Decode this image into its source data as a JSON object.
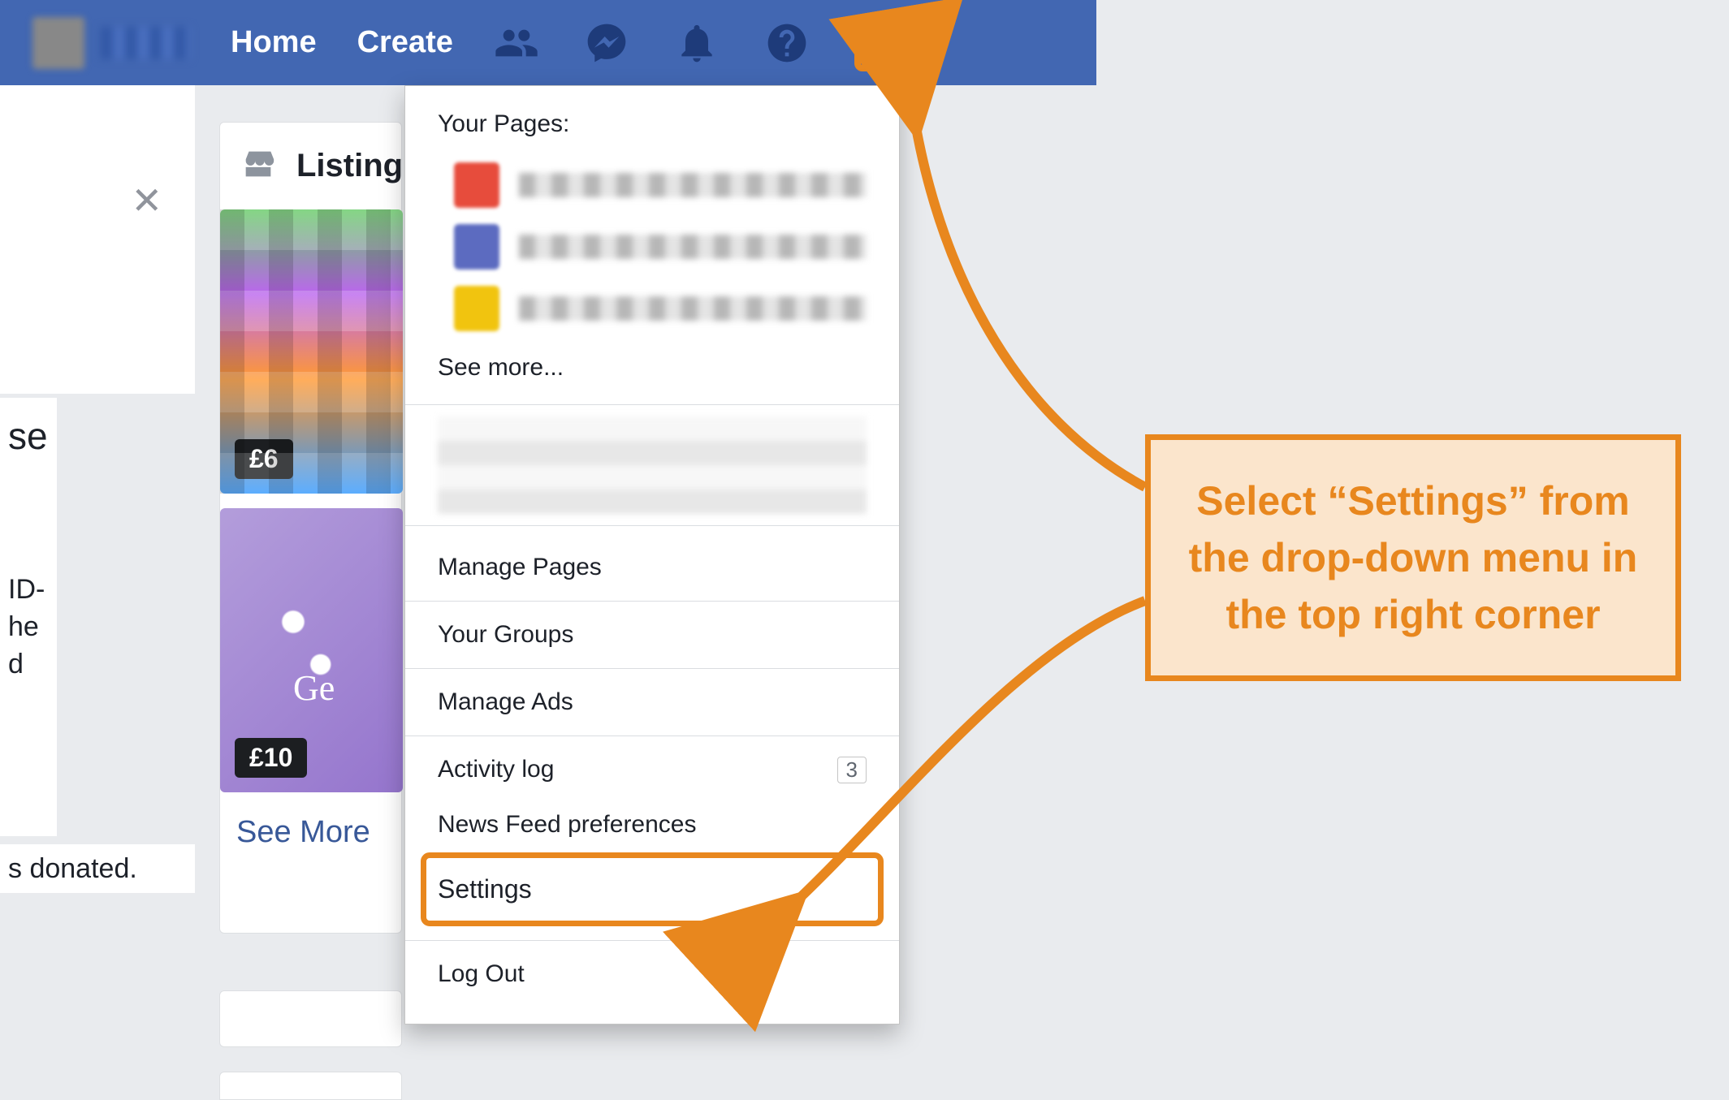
{
  "topbar": {
    "nav": {
      "home": "Home",
      "create": "Create"
    }
  },
  "left": {
    "se_line": "se",
    "sub_line": "ID-\nhe\nd",
    "donated_line": "s donated."
  },
  "listing": {
    "header": "Listing",
    "prices": [
      "£6",
      "£10"
    ],
    "see_more": "See More"
  },
  "dropdown": {
    "your_pages_label": "Your Pages:",
    "see_more": "See more...",
    "items": {
      "manage_pages": "Manage Pages",
      "your_groups": "Your Groups",
      "manage_ads": "Manage Ads",
      "activity_log": "Activity log",
      "activity_count": "3",
      "news_feed_prefs": "News Feed preferences",
      "settings": "Settings",
      "log_out": "Log Out"
    }
  },
  "annotation": {
    "callout_text": "Select “Settings” from the drop-down menu in the top right corner"
  },
  "colors": {
    "accent": "#e8871e",
    "fb_blue": "#4267b2"
  }
}
